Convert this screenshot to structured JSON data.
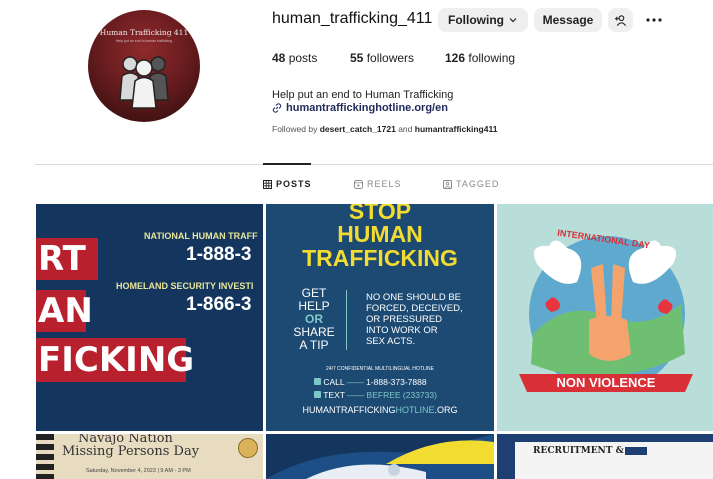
{
  "profile": {
    "avatar_title": "Human Trafficking 411",
    "avatar_subtitle": "Help put an end to human trafficking",
    "username": "human_trafficking_411",
    "following_button": "Following",
    "message_button": "Message",
    "posts_count": "48",
    "posts_label": "posts",
    "followers_count": "55",
    "followers_label": "followers",
    "following_count": "126",
    "following_label": "following",
    "bio": "Help put an end to Human Trafficking",
    "link": "humantraffickinghotline.org/en",
    "followed_prefix": "Followed by",
    "followed_user1": "desert_catch_1721",
    "followed_and": "and",
    "followed_user2": "humantrafficking411"
  },
  "tabs": [
    {
      "label": "POSTS",
      "icon": "grid-icon",
      "active": true
    },
    {
      "label": "REELS",
      "icon": "reels-icon",
      "active": false
    },
    {
      "label": "TAGGED",
      "icon": "tagged-icon",
      "active": false
    }
  ],
  "posts": {
    "p1": {
      "line1": "NATIONAL HUMAN TRAFF",
      "phone1": "1-888-3",
      "line2": "HOMELAND SECURITY INVESTI",
      "phone2": "1-866-3",
      "band1": "RT",
      "band2": "AN",
      "band3": "FICKING"
    },
    "p2": {
      "stop": "STOP",
      "human": "HUMAN",
      "trafficking": "TRAFFICKING",
      "get": "GET",
      "help": "HELP",
      "or": "OR",
      "share": "SHARE",
      "tip": "A TIP",
      "right1": "NO ONE SHOULD BE",
      "right2": "FORCED, DECEIVED,",
      "right3": "OR PRESSURED",
      "right4": "INTO WORK OR",
      "right5": "SEX ACTS.",
      "hotline": "24/7 CONFIDENTIAL MULTILINGUAL HOTLINE",
      "call": "CALL",
      "call_num": "1-888-373-7888",
      "text": "TEXT",
      "text_num": "BEFREE (233733)",
      "site_a": "HUMANTRAFFICKING",
      "site_b": "HOTLINE",
      "site_c": ".ORG"
    },
    "p3": {
      "intl": "INTERNATIONAL DAY",
      "banner": "NON VIOLENCE"
    },
    "p4": {
      "line1": "Navajo Nation",
      "line2": "Missing Persons Day",
      "small": "Saturday, November 4, 2023 | 9 AM - 3 PM"
    },
    "p6": {
      "line1": "RECRUITMENT &"
    }
  },
  "colors": {
    "navy": "#14365e",
    "red": "#b7202c",
    "yellow": "#f2dc31",
    "teal": "#7ec8c9"
  }
}
